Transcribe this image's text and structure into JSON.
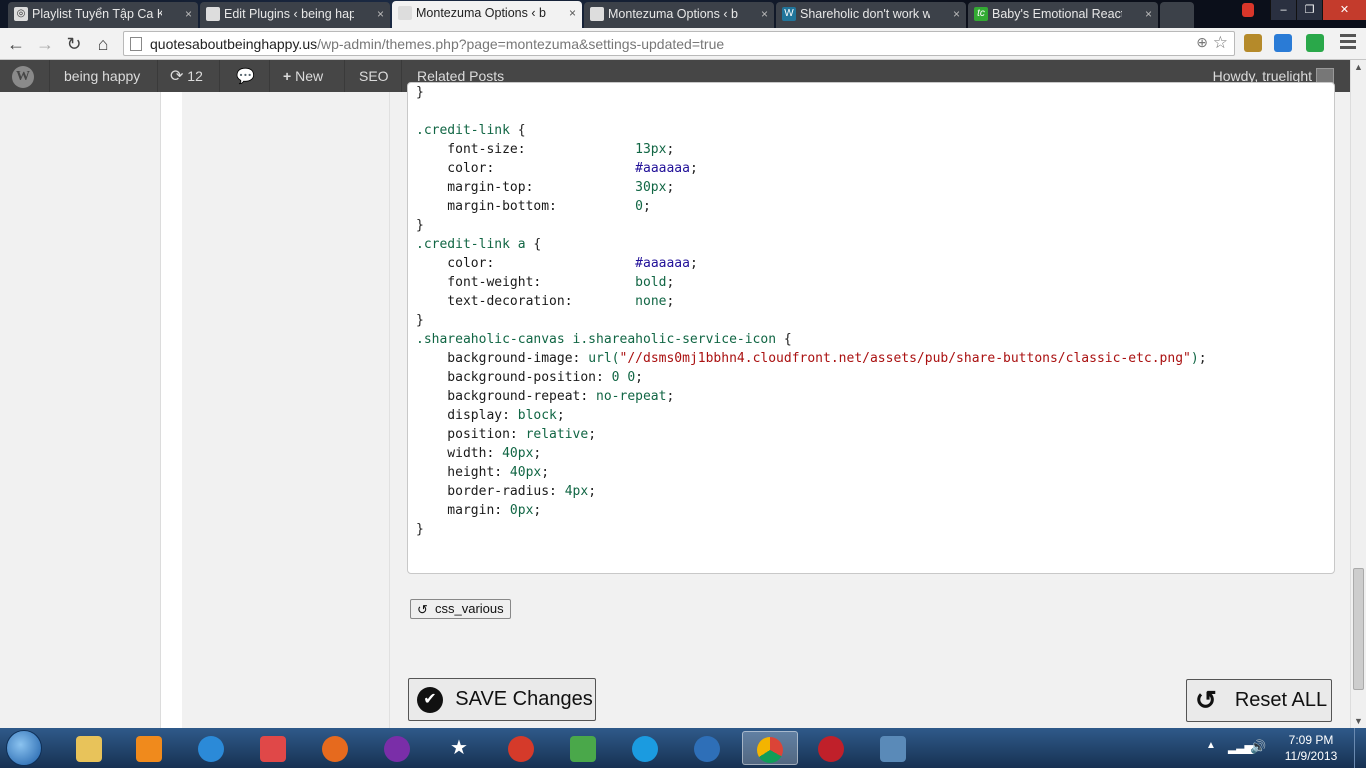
{
  "browser": {
    "tabs": [
      {
        "label": "Playlist Tuyển Tập Ca Khú",
        "icon": "globe-icon",
        "active": false
      },
      {
        "label": "Edit Plugins ‹ being happy",
        "icon": "page-icon",
        "active": false
      },
      {
        "label": "Montezuma Options ‹ bei",
        "icon": "page-icon",
        "active": true
      },
      {
        "label": "Montezuma Options ‹ bei",
        "icon": "page-icon",
        "active": false
      },
      {
        "label": "Shareholic don't work wit",
        "icon": "wordpress-icon",
        "active": false
      },
      {
        "label": "Baby's Emotional Reactio",
        "icon": "tc-icon",
        "active": false
      }
    ],
    "tab_close": "×",
    "url_host": "quotesaboutbeinghappy.us",
    "url_path": "/wp-admin/themes.php?page=montezuma&settings-updated=true"
  },
  "adminbar": {
    "site_name": "being happy",
    "updates_count": "12",
    "new_label": "New",
    "seo_label": "SEO",
    "related_posts_label": "Related Posts",
    "howdy": "Howdy, truelight"
  },
  "code_lines": [
    "}",
    "",
    ".credit-link {",
    "    font-size:              13px;",
    "    color:                  #aaaaaa;",
    "    margin-top:             30px;",
    "    margin-bottom:          0;",
    "}",
    ".credit-link a {",
    "    color:                  #aaaaaa;",
    "    font-weight:            bold;",
    "    text-decoration:        none;",
    "}",
    ".shareaholic-canvas i.shareaholic-service-icon {",
    "    background-image: url(\"//dsms0mj1bbhn4.cloudfront.net/assets/pub/share-buttons/classic-etc.png\");",
    "    background-position: 0 0;",
    "    background-repeat: no-repeat;",
    "    display: block;",
    "    position: relative;",
    "    width: 40px;",
    "    height: 40px;",
    "    border-radius: 4px;",
    "    margin: 0px;",
    "}"
  ],
  "buttons": {
    "revert": "css_various",
    "save": "SAVE Changes",
    "reset": "Reset ALL"
  },
  "taskbar": {
    "clock_time": "7:09 PM",
    "clock_date": "11/9/2013"
  },
  "colors": {
    "admin_bar": "#464646",
    "taskbar": "#1e3a5e",
    "code_selector": "#116644",
    "code_hex": "#221199",
    "code_string": "#aa1111"
  }
}
